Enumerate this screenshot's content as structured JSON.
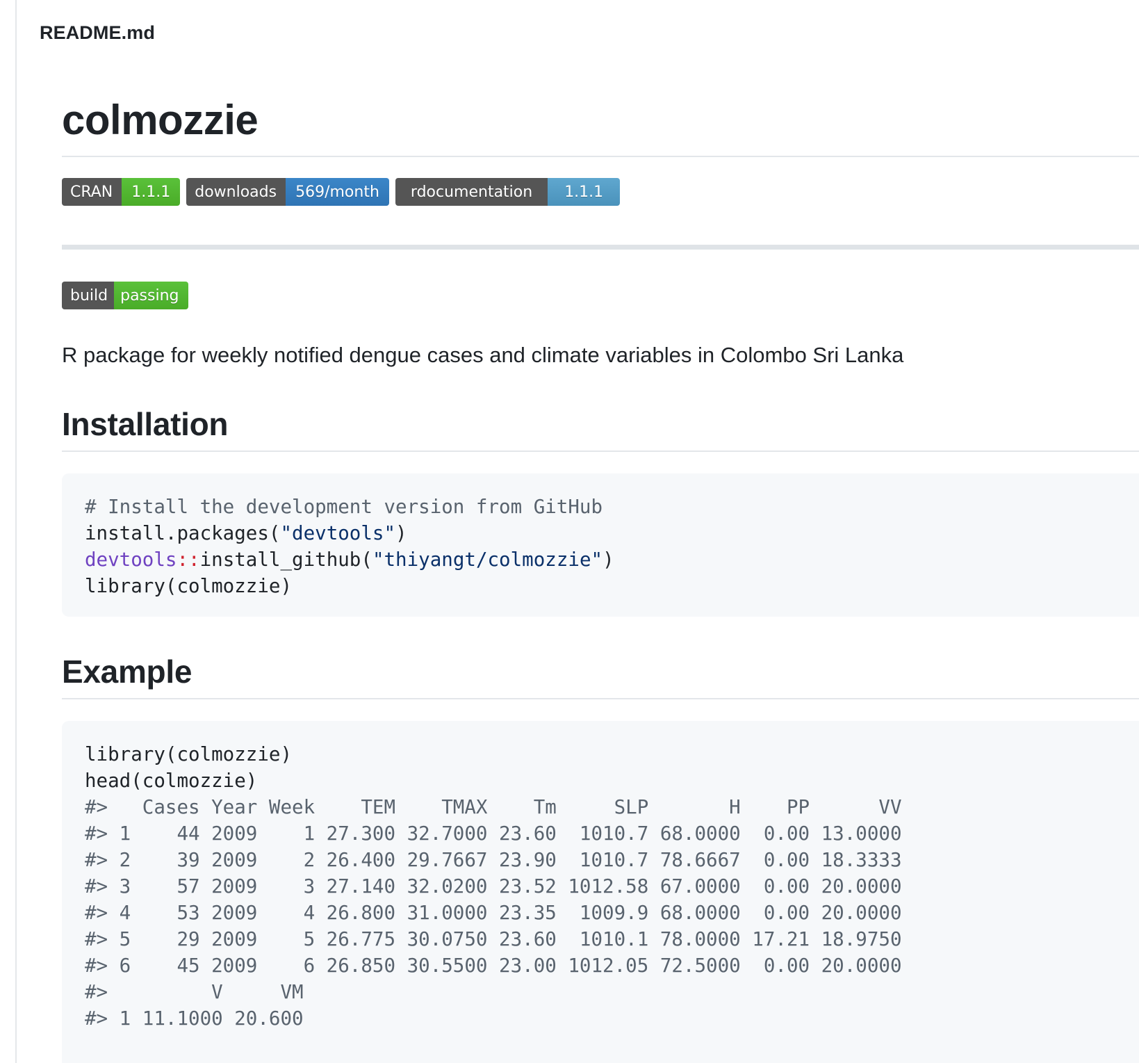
{
  "file_header": "README.md",
  "title": "colmozzie",
  "badges": [
    {
      "label": "CRAN",
      "value": "1.1.1",
      "color": "#4aac28"
    },
    {
      "label": "downloads",
      "value": "569/month",
      "color": "#2f74b4"
    },
    {
      "label": "rdocumentation",
      "value": "1.1.1",
      "color": "#4a92bb"
    }
  ],
  "build_badge": {
    "label": "build",
    "value": "passing",
    "color": "#4aac28"
  },
  "description": "R package for weekly notified dengue cases and climate variables in Colombo Sri Lanka",
  "installation": {
    "heading": "Installation",
    "comment": "# Install the development version from GitHub",
    "line2_fn": "install.packages(",
    "line2_str": "\"devtools\"",
    "line2_close": ")",
    "line3_ns": "devtools",
    "line3_op": "::",
    "line3_fn": "install_github(",
    "line3_str": "\"thiyangt/colmozzie\"",
    "line3_close": ")",
    "line4": "library(colmozzie)"
  },
  "example": {
    "heading": "Example",
    "lines": [
      "library(colmozzie)",
      "head(colmozzie)",
      "#>   Cases Year Week    TEM    TMAX    Tm     SLP       H    PP      VV",
      "#> 1    44 2009    1 27.300 32.7000 23.60  1010.7 68.0000  0.00 13.0000",
      "#> 2    39 2009    2 26.400 29.7667 23.90  1010.7 78.6667  0.00 18.3333",
      "#> 3    57 2009    3 27.140 32.0200 23.52 1012.58 67.0000  0.00 20.0000",
      "#> 4    53 2009    4 26.800 31.0000 23.35  1009.9 68.0000  0.00 20.0000",
      "#> 5    29 2009    5 26.775 30.0750 23.60  1010.1 78.0000 17.21 18.9750",
      "#> 6    45 2009    6 26.850 30.5500 23.00 1012.05 72.5000  0.00 20.0000",
      "#>         V     VM",
      "#> 1 11.1000 20.600"
    ]
  }
}
